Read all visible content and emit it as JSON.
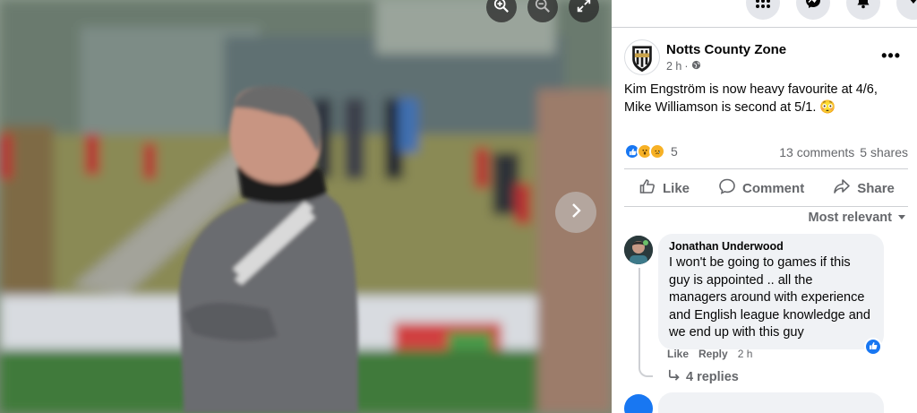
{
  "viewer": {
    "zoom_in": "zoom-in-icon",
    "zoom_out": "zoom-out-icon",
    "fullscreen": "fullscreen-icon",
    "next": "chevron-right-icon"
  },
  "topbar": {
    "buttons": [
      "menu-grid-icon",
      "messenger-icon",
      "notifications-icon",
      "account-caret-icon"
    ]
  },
  "post": {
    "page_name": "Notts County Zone",
    "time": "2 h",
    "dot": "·",
    "text": "Kim Engström is now heavy favourite at 4/6, Mike Williamson is second at 5/1. 😳",
    "reaction_count": "5",
    "comments": "13 comments",
    "shares": "5 shares"
  },
  "actions": {
    "like": "Like",
    "comment": "Comment",
    "share": "Share"
  },
  "sort_label": "Most relevant",
  "comment1": {
    "author": "Jonathan Underwood",
    "text": "I won't be going to games if this guy is appointed .. all the managers around with experience and English league knowledge and we end up with this guy",
    "like": "Like",
    "reply": "Reply",
    "time": "2 h",
    "replies": "4 replies"
  },
  "colors": {
    "accent": "#1877f2",
    "secondary_text": "#65676b",
    "bubble": "#f0f2f5"
  }
}
